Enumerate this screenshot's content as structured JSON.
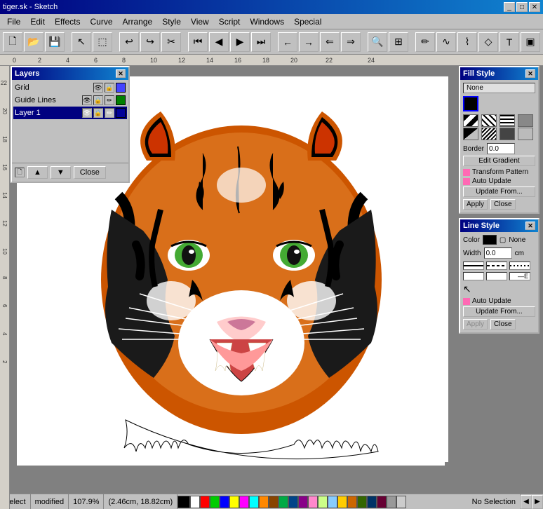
{
  "titleBar": {
    "title": "tiger.sk - Sketch",
    "controls": [
      "_",
      "□",
      "✕"
    ]
  },
  "menuBar": {
    "items": [
      "File",
      "Edit",
      "Effects",
      "Curve",
      "Arrange",
      "Style",
      "View",
      "Script",
      "Windows",
      "Special"
    ]
  },
  "ruler": {
    "numbers": [
      "0",
      "2",
      "4",
      "6",
      "8",
      "10",
      "12",
      "14",
      "16",
      "18",
      "20",
      "22",
      "24"
    ]
  },
  "layers": {
    "title": "Layers",
    "items": [
      {
        "name": "Grid",
        "visible": true,
        "selected": false
      },
      {
        "name": "Guide Lines",
        "visible": true,
        "selected": false
      },
      {
        "name": "Layer 1",
        "visible": true,
        "selected": true
      }
    ],
    "buttons": [
      "▲",
      "▼",
      "Close"
    ]
  },
  "fillStyle": {
    "title": "Fill Style",
    "noneLabel": "None",
    "borderLabel": "Border",
    "borderValue": "0.0",
    "editGradientLabel": "Edit Gradient",
    "transformPatternLabel": "Transform Pattern",
    "autoUpdateLabel": "Auto Update",
    "updateFromLabel": "Update From...",
    "applyLabel": "Apply",
    "closeLabel": "Close",
    "swatches": [
      "#000000",
      "#333333",
      "#555555",
      "#777777",
      "#999999",
      "#bbbbbb",
      "#dddddd",
      "#ffffff",
      "#442211",
      "#664422",
      "#886633",
      "#aa8844",
      "#ccaa66",
      "#eedd99",
      "#ffeecc",
      "#ffffee"
    ]
  },
  "lineStyle": {
    "title": "Line Style",
    "colorLabel": "Color",
    "noneLabel": "None",
    "widthLabel": "Width",
    "widthValue": "0.0",
    "widthUnit": "cm",
    "autoUpdateLabel": "Auto Update",
    "updateFromLabel": "Update From...",
    "applyLabel": "Apply",
    "closeLabel": "Close"
  },
  "statusBar": {
    "tool": "Select",
    "modified": "modified",
    "zoom": "107.9%",
    "position": "(2.46cm, 18.82cm)",
    "selection": "No Selection"
  },
  "colorBar": {
    "colors": [
      "#000000",
      "#ffffff",
      "#ff0000",
      "#00cc00",
      "#0000ff",
      "#ffff00",
      "#ff00ff",
      "#00ffff",
      "#ff8800",
      "#884400",
      "#00aa44",
      "#004488",
      "#880088",
      "#ff88cc",
      "#ccff88",
      "#88ccff",
      "#ffcc00",
      "#cc6600",
      "#336600",
      "#003366",
      "#660033",
      "#999999",
      "#cccccc"
    ]
  }
}
